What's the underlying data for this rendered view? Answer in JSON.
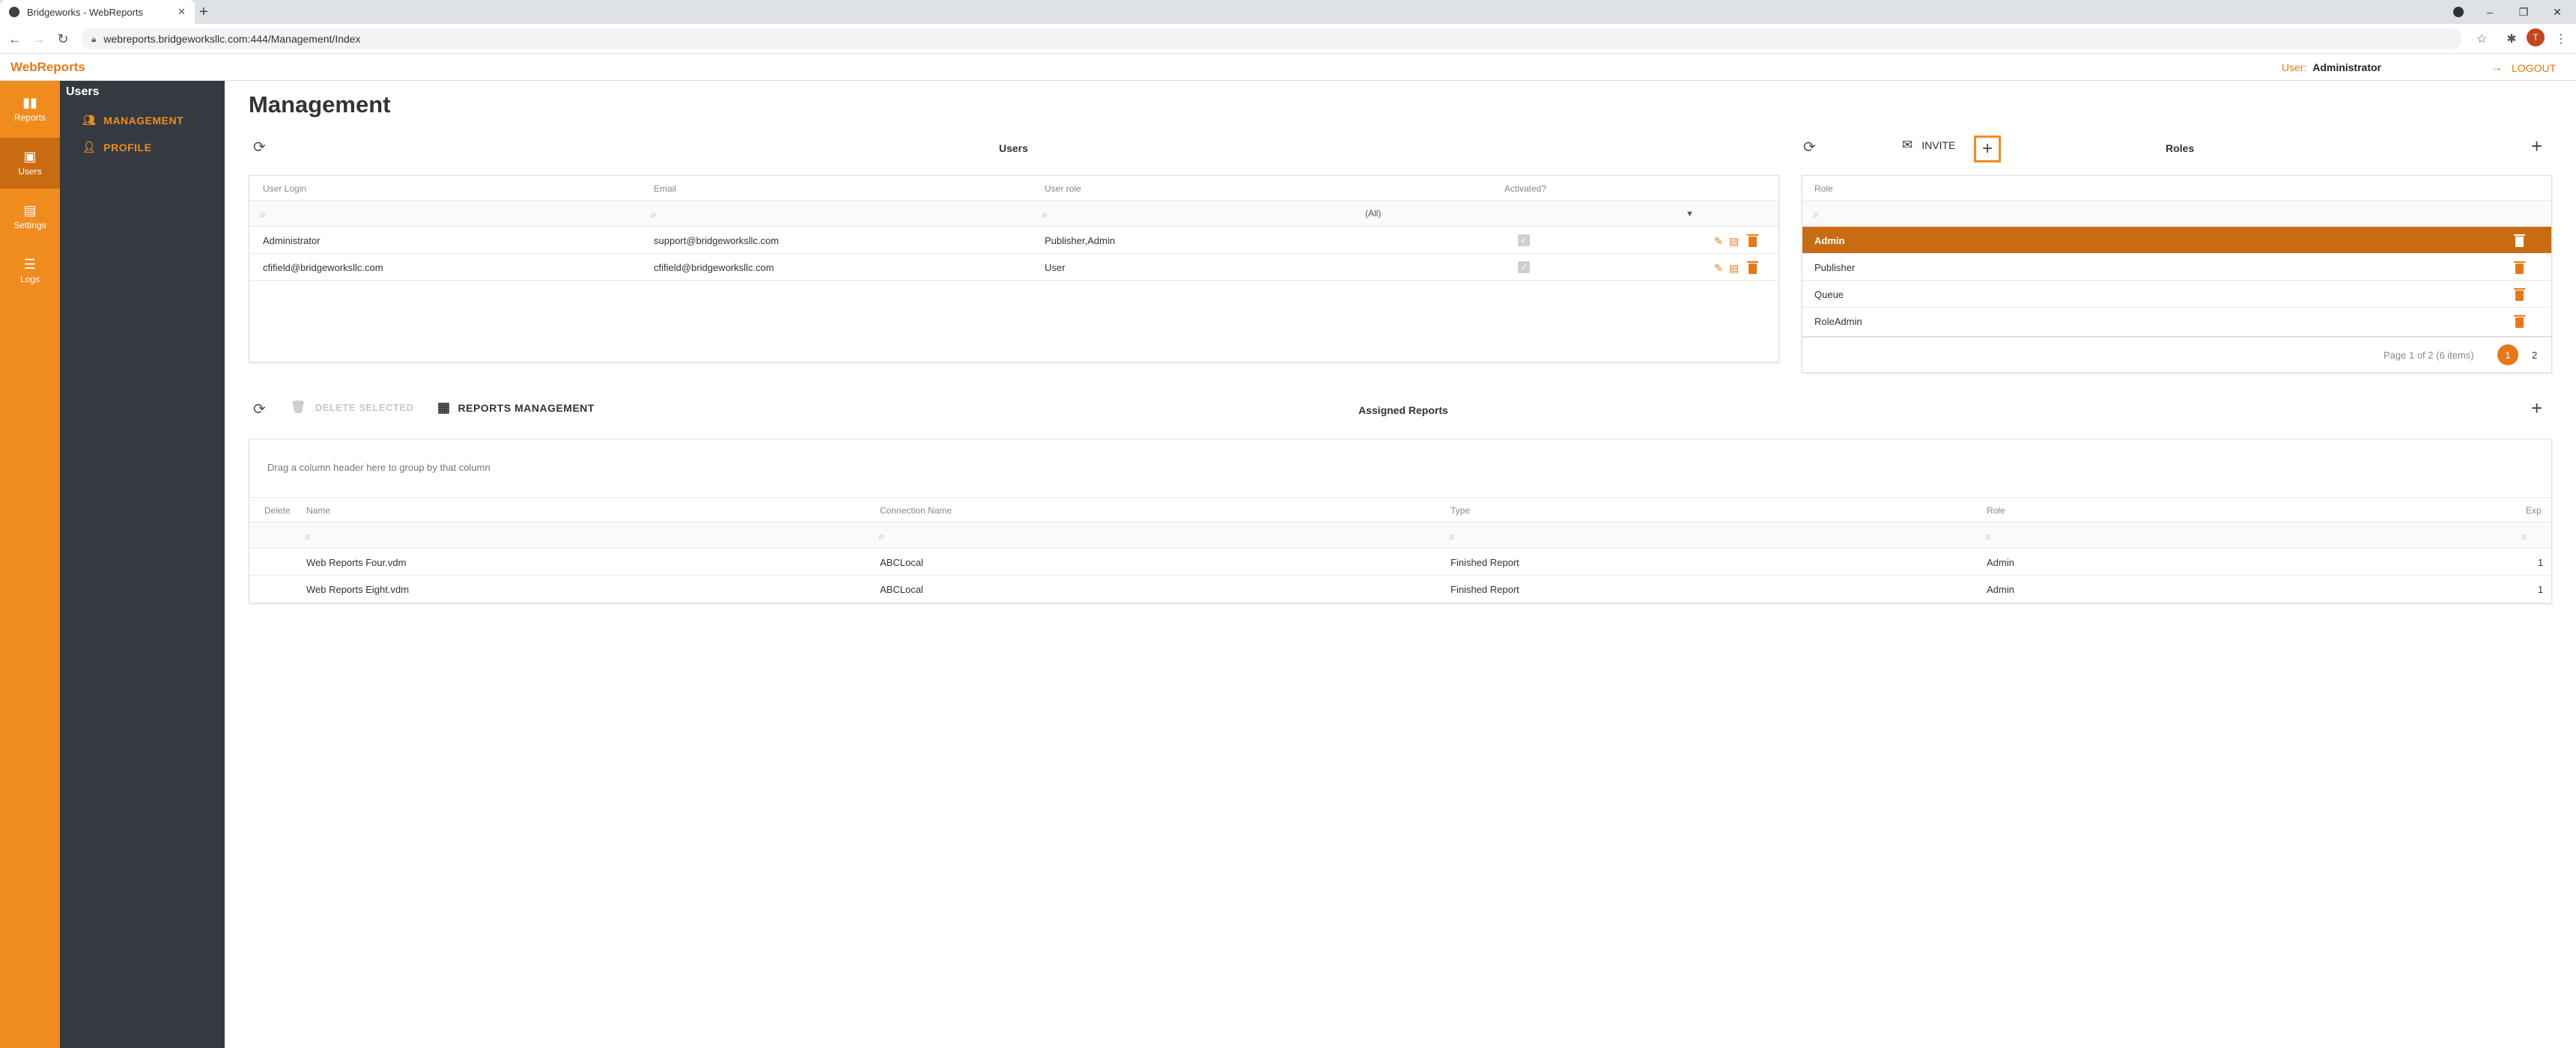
{
  "browser": {
    "tab_title": "Bridgeworks - WebReports",
    "tab_close": "✕",
    "new_tab": "+",
    "url": "webreports.bridgeworksllc.com:444/Management/Index",
    "profile_initial": "T",
    "win_minimize": "–",
    "win_restore": "❐",
    "win_close": "✕"
  },
  "header": {
    "brand": "WebReports",
    "user_label": "User:",
    "user_name": "Administrator",
    "logout": "LOGOUT"
  },
  "leftnav": [
    {
      "label": "Reports",
      "icon": "bar-chart-icon"
    },
    {
      "label": "Users",
      "icon": "user-badge-icon"
    },
    {
      "label": "Settings",
      "icon": "briefcase-icon"
    },
    {
      "label": "Logs",
      "icon": "logs-icon"
    }
  ],
  "subnav": {
    "title": "Users",
    "items": [
      {
        "label": "MANAGEMENT",
        "icon": "people-icon"
      },
      {
        "label": "PROFILE",
        "icon": "person-icon"
      }
    ]
  },
  "page": {
    "title": "Management"
  },
  "users_panel": {
    "title": "Users",
    "invite": "INVITE",
    "columns": [
      "User Login",
      "Email",
      "User role",
      "Activated?"
    ],
    "filter_role": "(All)",
    "rows": [
      {
        "login": "Administrator",
        "email": "support@bridgeworksllc.com",
        "role": "Publisher,Admin",
        "activated": true
      },
      {
        "login": "cfifield@bridgeworksllc.com",
        "email": "cfifield@bridgeworksllc.com",
        "role": "User",
        "activated": true
      }
    ]
  },
  "roles_panel": {
    "title": "Roles",
    "column": "Role",
    "rows": [
      "Admin",
      "Publisher",
      "Queue",
      "RoleAdmin"
    ],
    "selected": "Admin",
    "pager_info": "Page 1 of 2 (6 items)",
    "pages": [
      "1",
      "2"
    ]
  },
  "assigned_panel": {
    "title": "Assigned Reports",
    "delete_selected": "DELETE SELECTED",
    "reports_management": "REPORTS MANAGEMENT",
    "group_hint": "Drag a column header here to group by that column",
    "columns": [
      "Delete",
      "Name",
      "Connection Name",
      "Type",
      "Role",
      "Exp"
    ],
    "rows": [
      {
        "name": "Web Reports Four.vdm",
        "connection": "ABCLocal",
        "type": "Finished Report",
        "role": "Admin",
        "exp": "1"
      },
      {
        "name": "Web Reports Eight.vdm",
        "connection": "ABCLocal",
        "type": "Finished Report",
        "role": "Admin",
        "exp": "1"
      }
    ]
  },
  "colors": {
    "accent": "#f08c1e",
    "accent_dark": "#c96b12",
    "sidebar": "#343a40"
  }
}
